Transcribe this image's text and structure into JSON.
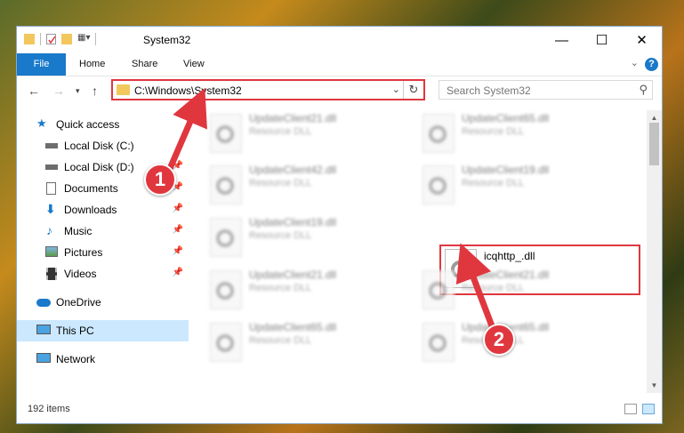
{
  "window": {
    "title": "System32",
    "controls": {
      "minimize": "—",
      "maximize": "☐",
      "close": "✕"
    }
  },
  "ribbon": {
    "tabs": [
      "File",
      "Home",
      "Share",
      "View"
    ],
    "help": "?"
  },
  "address_bar": {
    "path": "C:\\Windows\\System32",
    "refresh_icon": "refresh-icon"
  },
  "search": {
    "placeholder": "Search System32"
  },
  "sidebar": {
    "items": [
      {
        "label": "Quick access",
        "icon": "star-icon",
        "pinned": false
      },
      {
        "label": "Local Disk (C:)",
        "icon": "drive-icon",
        "pinned": false
      },
      {
        "label": "Local Disk (D:)",
        "icon": "drive-icon",
        "pinned": true
      },
      {
        "label": "Documents",
        "icon": "documents-icon",
        "pinned": true
      },
      {
        "label": "Downloads",
        "icon": "downloads-icon",
        "pinned": true
      },
      {
        "label": "Music",
        "icon": "music-icon",
        "pinned": true
      },
      {
        "label": "Pictures",
        "icon": "pictures-icon",
        "pinned": true
      },
      {
        "label": "Videos",
        "icon": "videos-icon",
        "pinned": true
      },
      {
        "label": "OneDrive",
        "icon": "cloud-icon",
        "pinned": false
      },
      {
        "label": "This PC",
        "icon": "computer-icon",
        "pinned": false,
        "selected": true
      },
      {
        "label": "Network",
        "icon": "network-icon",
        "pinned": false
      }
    ]
  },
  "files": [
    {
      "name": "UpdateClient21.dll",
      "type": "Resource DLL"
    },
    {
      "name": "UpdateClient65.dll",
      "type": "Resource DLL"
    },
    {
      "name": "UpdateClient42.dll",
      "type": "Resource DLL"
    },
    {
      "name": "UpdateClient19.dll",
      "type": "Resource DLL"
    },
    {
      "name": "UpdateClient19.dll",
      "type": "Resource DLL"
    },
    {
      "name": "icqhttp_.dll",
      "type": ""
    },
    {
      "name": "UpdateClient21.dll",
      "type": "Resource DLL"
    },
    {
      "name": "UpdateClient21.dll",
      "type": "Resource DLL"
    },
    {
      "name": "UpdateClient65.dll",
      "type": "Resource DLL"
    },
    {
      "name": "UpdateClient65.dll",
      "type": "Resource DLL"
    }
  ],
  "status": {
    "item_count": "192 items"
  },
  "callouts": [
    "1",
    "2"
  ],
  "colors": {
    "accent": "#1979ca",
    "highlight": "#e0373f",
    "selected": "#cce8ff"
  }
}
